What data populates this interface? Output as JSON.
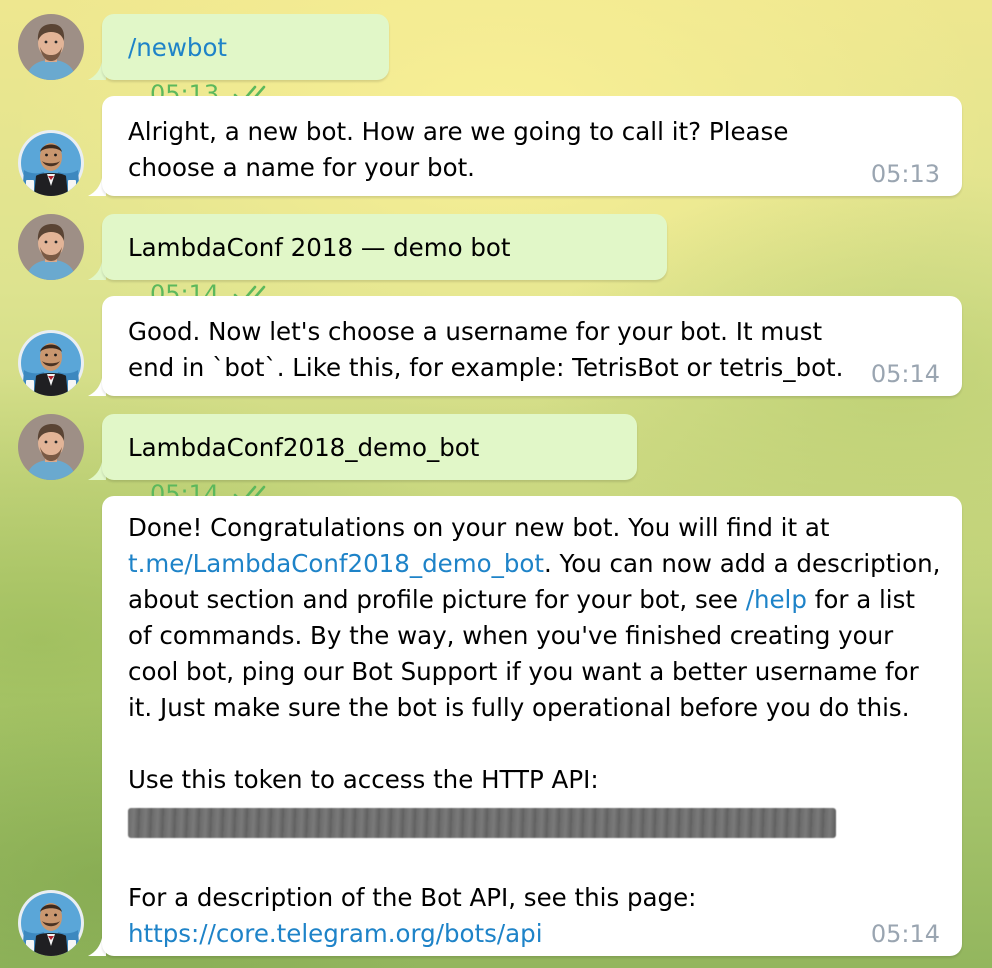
{
  "messages": [
    {
      "from": "user",
      "text": "/newbot",
      "is_command": true,
      "time": "05:13",
      "read": true
    },
    {
      "from": "bot",
      "text": "Alright, a new bot. How are we going to call it? Please choose a name for your bot.",
      "time": "05:13"
    },
    {
      "from": "user",
      "text": "LambdaConf 2018 — demo bot",
      "time": "05:14",
      "read": true
    },
    {
      "from": "bot",
      "text": "Good. Now let's choose a username for your bot. It must end in `bot`. Like this, for example: TetrisBot or tetris_bot.",
      "time": "05:14"
    },
    {
      "from": "user",
      "text": "LambdaConf2018_demo_bot",
      "time": "05:14",
      "read": true
    },
    {
      "from": "bot",
      "time": "05:14",
      "text_1": "Done! Congratulations on your new bot. You will find it at",
      "link_1": "t.me/LambdaConf2018_demo_bot",
      "text_2": ". You can now add a description, about section and profile picture for your bot, see",
      "link_2": "/help",
      "text_3": "for a list of commands. By the way, when you've finished creating your cool bot, ping our Bot Support if you want a better username for it. Just make sure the bot is fully operational before you do this.",
      "token_label": "Use this token to access the HTTP API:",
      "api_label": "For a description of the Bot API, see this page:",
      "api_link": "https://core.telegram.org/bots/api"
    }
  ],
  "icons": {
    "read_receipt": "double-check-icon",
    "user_avatar": "user-avatar",
    "bot_avatar": "botfather-avatar"
  },
  "colors": {
    "outgoing_bubble": "#e1f7c8",
    "incoming_bubble": "#ffffff",
    "outgoing_time": "#5cb85c",
    "incoming_time": "#9aa5b1",
    "link": "#1e83c8"
  }
}
